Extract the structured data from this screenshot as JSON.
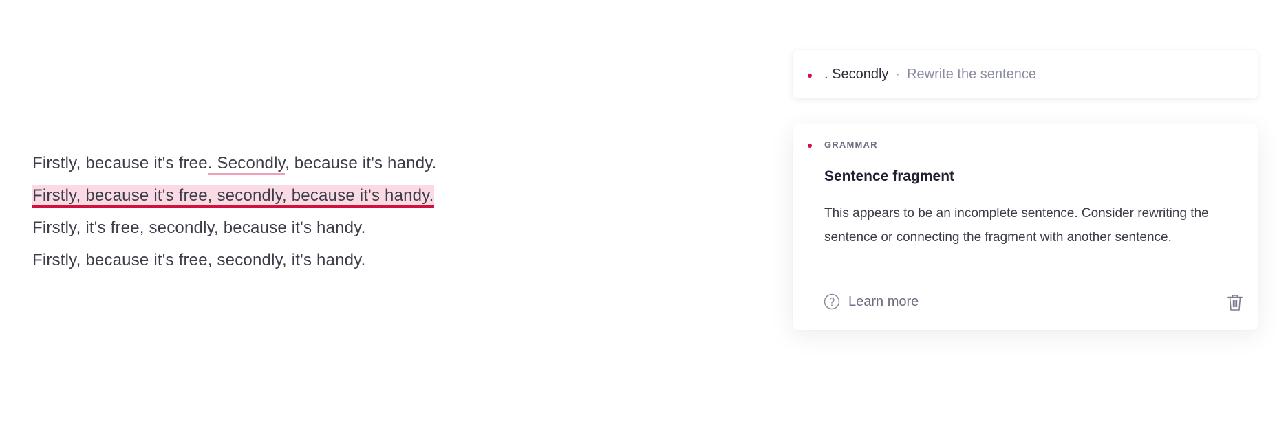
{
  "editor": {
    "lines": [
      {
        "before": "Firstly, because it's free",
        "flagged": ". Secondly",
        "after": ", because it's handy."
      },
      {
        "text": "Firstly, because it's free, secondly, because it's handy."
      },
      {
        "text": "Firstly, it's free, secondly, because it's handy."
      },
      {
        "text": "Firstly, because it's free, secondly, it's handy."
      }
    ]
  },
  "suggestions": {
    "collapsed": {
      "word": ". Secondly",
      "separator": "·",
      "action": "Rewrite the sentence"
    },
    "expanded": {
      "category": "GRAMMAR",
      "title": "Sentence fragment",
      "description": "This appears to be an incomplete sentence. Consider rewriting the sentence or connecting the fragment with another sentence.",
      "learn_more": "Learn more"
    }
  },
  "colors": {
    "accent_red": "#d1123f",
    "highlight_bg": "#fbdbe3",
    "soft_underline": "#f0a0b4",
    "muted_text": "#8a8da0"
  },
  "icons": [
    "dot-indicator",
    "question-circle-icon",
    "trash-icon"
  ]
}
